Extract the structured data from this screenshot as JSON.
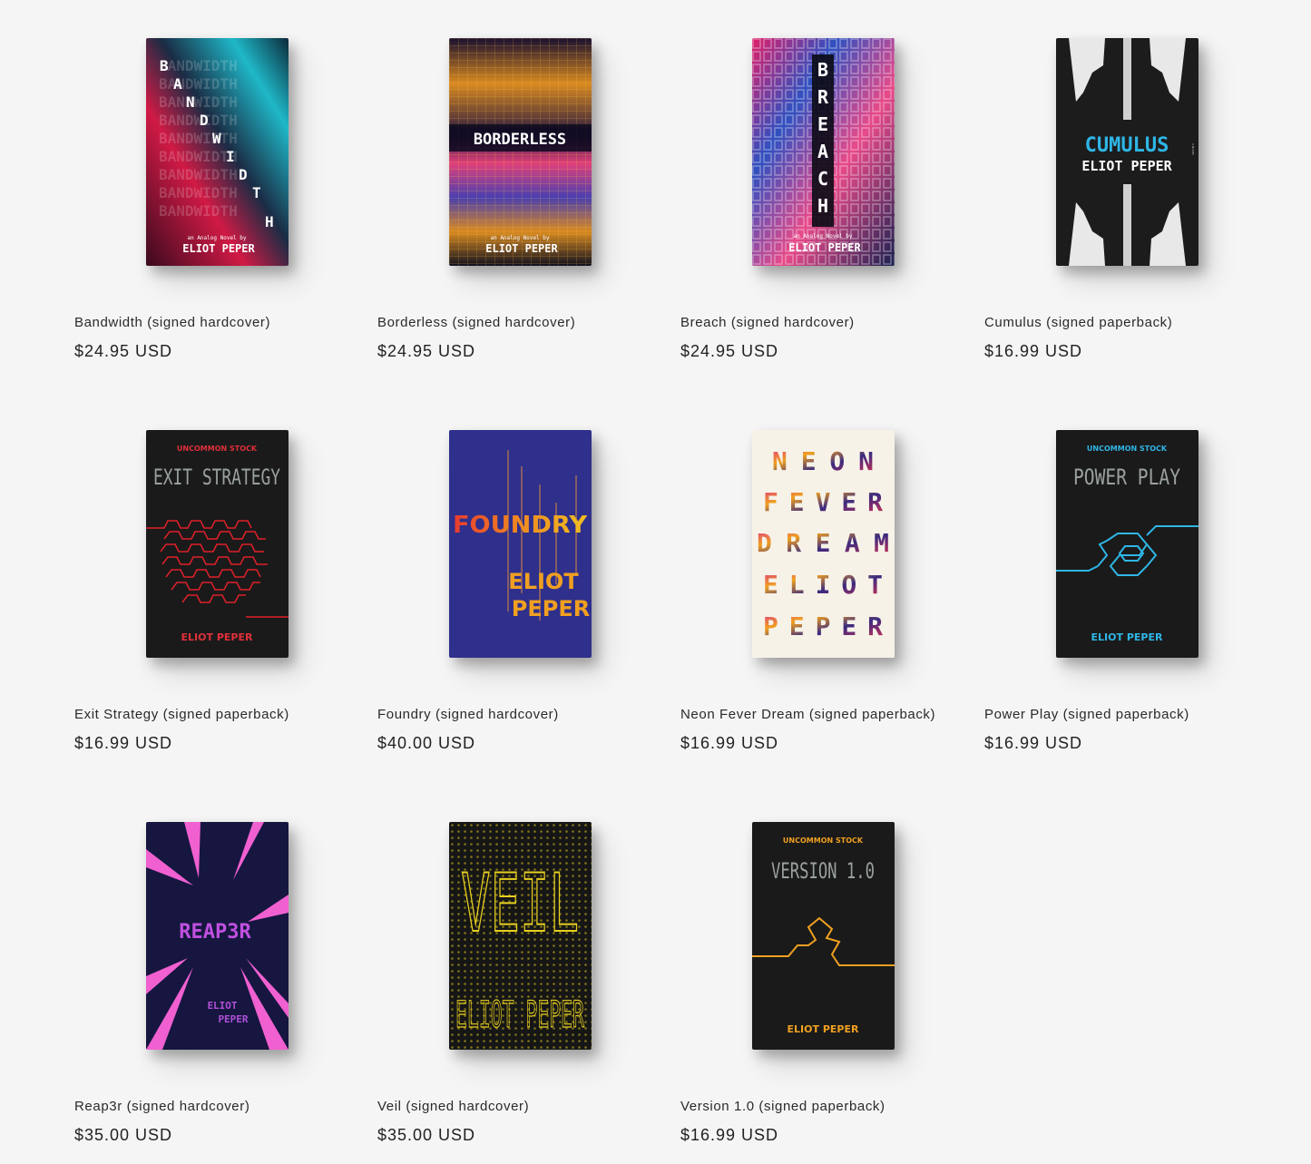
{
  "products": [
    {
      "title": "Bandwidth (signed hardcover)",
      "price": "$24.95 USD",
      "cover": {
        "main": "BANDWIDTH",
        "tagline": "an Analog Novel by",
        "author": "ELIOT PEPER",
        "letters": [
          "B",
          "A",
          "N",
          "D",
          "W",
          "I",
          "D",
          "T",
          "H"
        ]
      }
    },
    {
      "title": "Borderless (signed hardcover)",
      "price": "$24.95 USD",
      "cover": {
        "main": "BORDERLESS",
        "tagline": "an Analog Novel by",
        "author": "ELIOT PEPER"
      }
    },
    {
      "title": "Breach (signed hardcover)",
      "price": "$24.95 USD",
      "cover": {
        "main": "BREACH",
        "tagline": "an Analog Novel by",
        "author": "ELIOT PEPER",
        "letters": [
          "B",
          "R",
          "E",
          "A",
          "C",
          "H"
        ]
      }
    },
    {
      "title": "Cumulus (signed paperback)",
      "price": "$16.99 USD",
      "cover": {
        "main": "CUMULUS",
        "tagline": "A NOVEL",
        "author": "ELIOT PEPER"
      }
    },
    {
      "title": "Exit Strategy (signed paperback)",
      "price": "$16.99 USD",
      "cover": {
        "series": "UNCOMMON STOCK",
        "main": "EXIT STRATEGY",
        "author": "ELIOT PEPER"
      }
    },
    {
      "title": "Foundry (signed hardcover)",
      "price": "$40.00 USD",
      "cover": {
        "main": "FOUNDRY",
        "author_line1": "ELIOT",
        "author_line2": "PEPER"
      }
    },
    {
      "title": "Neon Fever Dream (signed paperback)",
      "price": "$16.99 USD",
      "cover": {
        "lines": [
          "NEON",
          "FEVER",
          "DREAM",
          "ELIOT",
          "PEPER"
        ]
      }
    },
    {
      "title": "Power Play (signed paperback)",
      "price": "$16.99 USD",
      "cover": {
        "series": "UNCOMMON STOCK",
        "main": "POWER PLAY",
        "author": "ELIOT PEPER"
      }
    },
    {
      "title": "Reap3r (signed hardcover)",
      "price": "$35.00 USD",
      "cover": {
        "main": "REAP3R",
        "author_line1": "ELIOT",
        "author_line2": "PEPER"
      }
    },
    {
      "title": "Veil (signed hardcover)",
      "price": "$35.00 USD",
      "cover": {
        "main": "VEIL",
        "author": "ELIOT PEPER"
      }
    },
    {
      "title": "Version 1.0 (signed paperback)",
      "price": "$16.99 USD",
      "cover": {
        "series": "UNCOMMON STOCK",
        "main": "VERSION 1.0",
        "author": "ELIOT PEPER"
      }
    }
  ],
  "colors": {
    "background": "#f5f5f5",
    "text": "#222222"
  }
}
